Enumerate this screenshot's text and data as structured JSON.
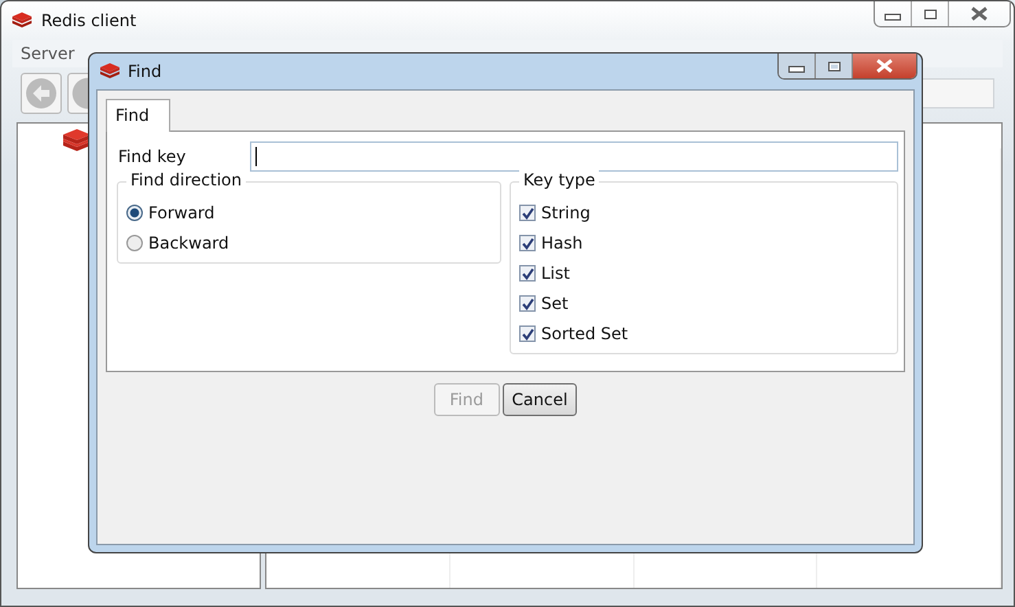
{
  "main_window": {
    "title": "Redis client",
    "menu": [
      {
        "label": "Server"
      }
    ]
  },
  "dialog": {
    "title": "Find",
    "tabs": [
      {
        "label": "Find",
        "selected": true
      }
    ],
    "find_key": {
      "label": "Find key"
    },
    "direction": {
      "title": "Find direction",
      "options": [
        {
          "label": "Forward",
          "selected": true
        },
        {
          "label": "Backward",
          "selected": false
        }
      ]
    },
    "key_type": {
      "title": "Key type",
      "options": [
        {
          "label": "String",
          "checked": true
        },
        {
          "label": "Hash",
          "checked": true
        },
        {
          "label": "List",
          "checked": true
        },
        {
          "label": "Set",
          "checked": true
        },
        {
          "label": "Sorted Set",
          "checked": true
        }
      ]
    },
    "buttons": [
      {
        "label": "Find",
        "disabled": true
      },
      {
        "label": "Cancel",
        "disabled": false
      }
    ]
  }
}
